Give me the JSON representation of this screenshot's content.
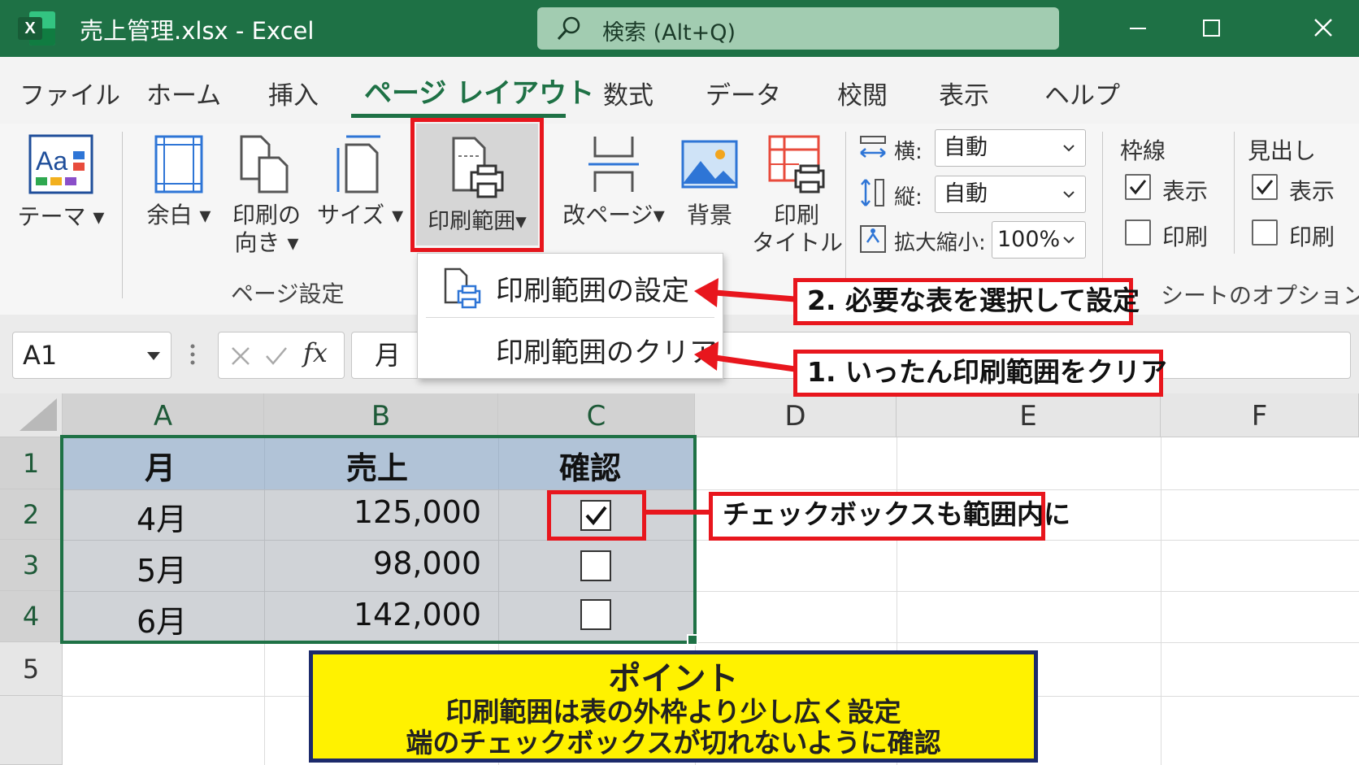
{
  "window": {
    "title": "売上管理.xlsx  -  Excel",
    "app_icon_letter": "X",
    "search_placeholder": "検索 (Alt+Q)"
  },
  "tabs": [
    "ファイル",
    "ホーム",
    "挿入",
    "ページ レイアウト",
    "数式",
    "データ",
    "校閲",
    "表示",
    "ヘルプ"
  ],
  "active_tab": "ページ レイアウト",
  "ribbon": {
    "theme_label": "テーマ",
    "margins_label": "余白",
    "orientation_label_1": "印刷の",
    "orientation_label_2": "向き",
    "size_label": "サイズ",
    "print_area_label": "印刷範囲",
    "breaks_label": "改ページ",
    "background_label": "背景",
    "print_titles_label_1": "印刷",
    "print_titles_label_2": "タイトル",
    "page_setup_group": "ページ設定",
    "width_label": "横:",
    "width_value": "自動",
    "height_label": "縦:",
    "height_value": "自動",
    "scale_label": "拡大縮小:",
    "scale_value": "100%",
    "gridlines_group": "枠線",
    "gridlines_view": "表示",
    "gridlines_print": "印刷",
    "headings_group": "見出し",
    "headings_view": "表示",
    "headings_print": "印刷",
    "sheet_options_group": "シートのオプション"
  },
  "print_area_menu": {
    "set": "印刷範囲の設定",
    "clear": "印刷範囲のクリア"
  },
  "formula_bar": {
    "name_box": "A1",
    "fx": "fx",
    "content": "月"
  },
  "grid": {
    "columns": [
      "A",
      "B",
      "C",
      "D",
      "E",
      "F"
    ],
    "rows": [
      "1",
      "2",
      "3",
      "4",
      "5"
    ],
    "header": [
      "月",
      "売上",
      "確認"
    ],
    "data": [
      {
        "month": "4月",
        "sales": "125,000",
        "checked": true
      },
      {
        "month": "5月",
        "sales": "98,000",
        "checked": false
      },
      {
        "month": "6月",
        "sales": "142,000",
        "checked": false
      }
    ]
  },
  "callouts": {
    "step2": "2. 必要な表を選択して設定",
    "step1": "1. いったん印刷範囲をクリア",
    "checkbox": "チェックボックスも範囲内に"
  },
  "point": {
    "title": "ポイント",
    "line1": "印刷範囲は表の外枠より少し広く設定",
    "line2": "端のチェックボックスが切れないように確認"
  },
  "colors": {
    "excel_green": "#1e7145",
    "highlight_red": "#e8161d",
    "point_yellow": "#fff200",
    "point_border": "#1c2a6b"
  }
}
